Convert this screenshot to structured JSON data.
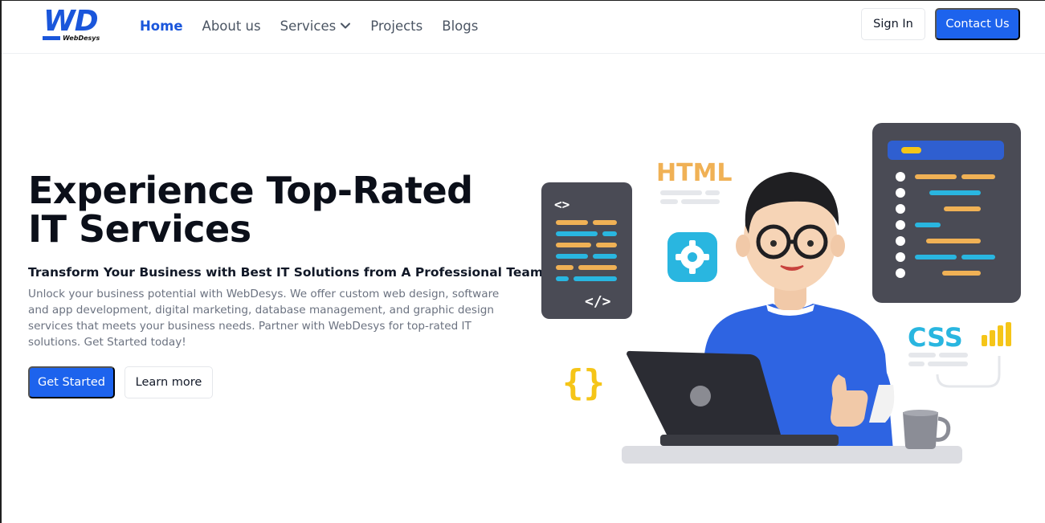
{
  "brand": {
    "logo_text": "WD",
    "logo_subtext": "WebDesys"
  },
  "nav": {
    "links": [
      {
        "label": "Home",
        "active": true
      },
      {
        "label": "About us",
        "active": false
      },
      {
        "label": "Services",
        "active": false,
        "dropdown": true
      },
      {
        "label": "Projects",
        "active": false
      },
      {
        "label": "Blogs",
        "active": false
      }
    ],
    "sign_in": "Sign In",
    "contact": "Contact Us"
  },
  "hero": {
    "title": "Experience Top-Rated IT Services",
    "subtitle": "Transform Your Business with Best IT Solutions from A Professional Team",
    "description": "Unlock your business potential with WebDesys. We offer custom web design, software and app development, digital marketing, database management, and graphic design services that meets your business needs. Partner with WebDesys for top-rated IT solutions. Get Started today!",
    "cta_primary": "Get Started",
    "cta_secondary": "Learn more"
  },
  "illustration": {
    "html_label": "HTML",
    "css_label": "CSS",
    "code_tag_open": "<>",
    "code_tag_close": "</>",
    "braces": "{}",
    "icons": [
      "code-panel-icon",
      "gear-icon",
      "laptop-icon",
      "mug-icon",
      "bar-chart-icon",
      "developer-avatar"
    ]
  },
  "colors": {
    "accent": "#1d63ed",
    "text_dark": "#0b0f19",
    "text_muted": "#6b7280",
    "orange_code": "#f0b155",
    "cyan_code": "#29b6e0",
    "panel_dark": "#4a4b55"
  }
}
